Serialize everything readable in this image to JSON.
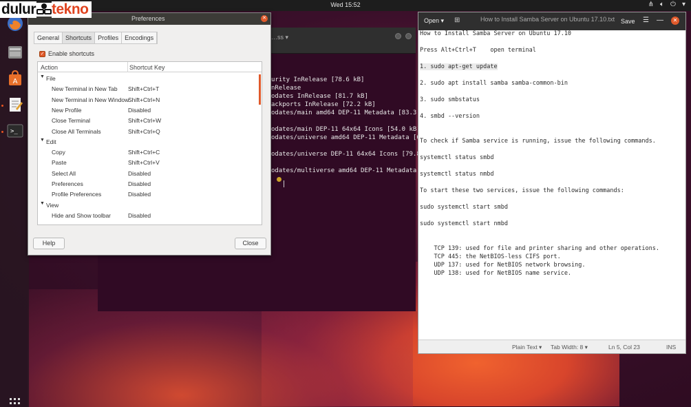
{
  "brand": {
    "part1": "dulur",
    "part2": "tekno"
  },
  "top_bar": {
    "clock": "Wed 15:52"
  },
  "launcher": {
    "items": [
      {
        "name": "firefox-icon"
      },
      {
        "name": "files-icon"
      },
      {
        "name": "software-center-icon"
      },
      {
        "name": "text-editor-icon"
      },
      {
        "name": "terminal-icon"
      }
    ]
  },
  "terminal": {
    "title": "…ss ▾",
    "lines": [
      "urity InRelease [78.6 kB]",
      "nRelease",
      "odates InRelease [81.7 kB]",
      "ackports InRelease [72.2 kB]",
      "odates/main amd64 DEP-11 Metadata [83.3 k",
      "",
      "odates/main DEP-11 64x64 Icons [54.0 kB]",
      "odates/universe amd64 DEP-11 Metadata [65",
      "",
      "odates/universe DEP-11 64x64 Icons [79.8",
      "",
      "odates/multiverse amd64 DEP-11 Metadata ["
    ]
  },
  "editor": {
    "open_label": "Open ▾",
    "save_label": "Save",
    "title": "How to Install Samba Server on Ubuntu 17.10.txt",
    "lines": [
      {
        "text": "How to Install Samba Server on Ubuntu 17.10",
        "hl": false
      },
      {
        "text": "Press Alt+Ctrl+T    open terminal",
        "hl": false
      },
      {
        "text": "1. sudo apt-get update",
        "hl": true
      },
      {
        "text": "2. sudo apt install samba samba-common-bin",
        "hl": false
      },
      {
        "text": "3. sudo smbstatus",
        "hl": false
      },
      {
        "text": "4. smbd --version",
        "hl": false
      },
      {
        "text": "To check if Samba service is running, issue the following commands.",
        "hl": false
      },
      {
        "text": "systemctl status smbd",
        "hl": false
      },
      {
        "text": "systemctl status nmbd",
        "hl": false
      },
      {
        "text": "To start these two services, issue the following commands:",
        "hl": false
      },
      {
        "text": "sudo systemctl start smbd",
        "hl": false
      },
      {
        "text": "sudo systemctl start nmbd",
        "hl": false
      },
      {
        "text": "    TCP 139: used for file and printer sharing and other operations.",
        "hl": false
      },
      {
        "text": "    TCP 445: the NetBIOS-less CIFS port.",
        "hl": false
      },
      {
        "text": "    UDP 137: used for NetBIOS network browsing.",
        "hl": false
      },
      {
        "text": "    UDP 138: used for NetBIOS name service.",
        "hl": false
      }
    ],
    "status": {
      "syntax": "Plain Text ▾",
      "tab_width": "Tab Width: 8 ▾",
      "position": "Ln 5, Col 23",
      "mode": "INS"
    }
  },
  "prefs": {
    "title": "Preferences",
    "tabs": [
      "General",
      "Shortcuts",
      "Profiles",
      "Encodings"
    ],
    "active_tab": "Shortcuts",
    "enable_shortcuts_label": "Enable shortcuts",
    "enable_shortcuts_checked": true,
    "columns": {
      "action": "Action",
      "shortcut": "Shortcut Key"
    },
    "rows": [
      {
        "type": "group",
        "action": "File",
        "key": ""
      },
      {
        "type": "item",
        "action": "New Terminal in New Tab",
        "key": "Shift+Ctrl+T"
      },
      {
        "type": "item",
        "action": "New Terminal in New Window",
        "key": "Shift+Ctrl+N"
      },
      {
        "type": "item",
        "action": "New Profile",
        "key": "Disabled"
      },
      {
        "type": "item",
        "action": "Close Terminal",
        "key": "Shift+Ctrl+W"
      },
      {
        "type": "item",
        "action": "Close All Terminals",
        "key": "Shift+Ctrl+Q"
      },
      {
        "type": "group",
        "action": "Edit",
        "key": ""
      },
      {
        "type": "item",
        "action": "Copy",
        "key": "Shift+Ctrl+C"
      },
      {
        "type": "item",
        "action": "Paste",
        "key": "Shift+Ctrl+V"
      },
      {
        "type": "item",
        "action": "Select All",
        "key": "Disabled"
      },
      {
        "type": "item",
        "action": "Preferences",
        "key": "Disabled"
      },
      {
        "type": "item",
        "action": "Profile Preferences",
        "key": "Disabled"
      },
      {
        "type": "group",
        "action": "View",
        "key": ""
      },
      {
        "type": "item",
        "action": "Hide and Show toolbar",
        "key": "Disabled"
      }
    ],
    "help_label": "Help",
    "close_label": "Close"
  },
  "colors": {
    "accent": "#e05a2b",
    "terminal_bg": "#300a24",
    "titlebar": "#3c3b37"
  }
}
